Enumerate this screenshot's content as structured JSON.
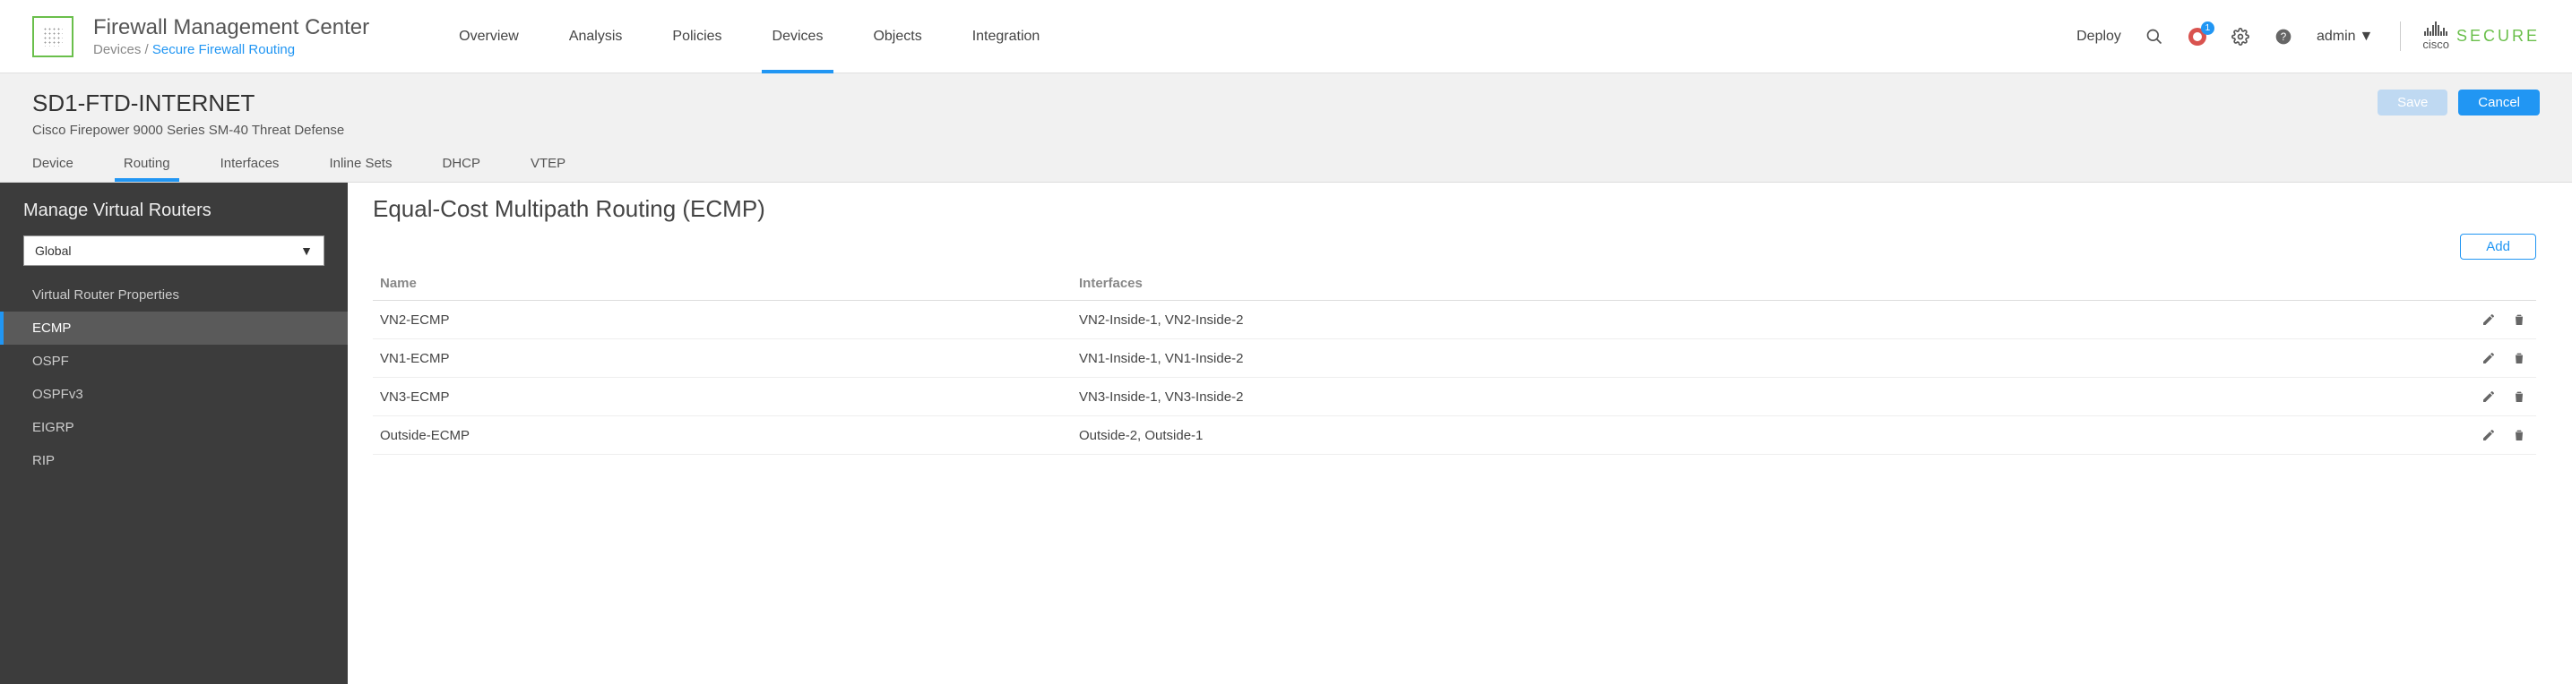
{
  "brand": {
    "title": "Firewall Management Center",
    "breadcrumb_prefix": "Devices / ",
    "breadcrumb_link": "Secure Firewall Routing"
  },
  "topnav": {
    "overview": "Overview",
    "analysis": "Analysis",
    "policies": "Policies",
    "devices": "Devices",
    "objects": "Objects",
    "integration": "Integration"
  },
  "topright": {
    "deploy": "Deploy",
    "admin": "admin",
    "notif_count": "1",
    "cisco": "cisco",
    "secure": "SECURE"
  },
  "subheader": {
    "title": "SD1-FTD-INTERNET",
    "subtitle": "Cisco Firepower 9000 Series SM-40 Threat Defense",
    "save": "Save",
    "cancel": "Cancel"
  },
  "subtabs": {
    "device": "Device",
    "routing": "Routing",
    "interfaces": "Interfaces",
    "inline_sets": "Inline Sets",
    "dhcp": "DHCP",
    "vtep": "VTEP"
  },
  "sidebar": {
    "heading": "Manage Virtual Routers",
    "selected": "Global",
    "items": {
      "vrp": "Virtual Router Properties",
      "ecmp": "ECMP",
      "ospf": "OSPF",
      "ospfv3": "OSPFv3",
      "eigrp": "EIGRP",
      "rip": "RIP"
    }
  },
  "content": {
    "title": "Equal-Cost Multipath Routing (ECMP)",
    "add": "Add",
    "columns": {
      "name": "Name",
      "interfaces": "Interfaces"
    },
    "rows": [
      {
        "name": "VN2-ECMP",
        "interfaces": "VN2-Inside-1, VN2-Inside-2"
      },
      {
        "name": "VN1-ECMP",
        "interfaces": "VN1-Inside-1, VN1-Inside-2"
      },
      {
        "name": "VN3-ECMP",
        "interfaces": "VN3-Inside-1, VN3-Inside-2"
      },
      {
        "name": "Outside-ECMP",
        "interfaces": "Outside-2, Outside-1"
      }
    ]
  }
}
